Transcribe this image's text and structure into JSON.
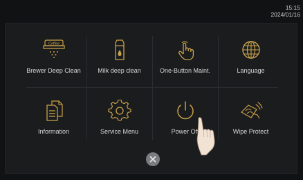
{
  "status": {
    "time": "15:15",
    "date": "2024/01/16"
  },
  "menu": {
    "items": [
      {
        "label": "Brewer Deep Clean",
        "icon": "coffee-brewer-icon"
      },
      {
        "label": "Milk deep clean",
        "icon": "milk-carton-icon"
      },
      {
        "label": "One-Button Maint.",
        "icon": "touch-hand-icon"
      },
      {
        "label": "Language",
        "icon": "globe-icon"
      },
      {
        "label": "Information",
        "icon": "documents-icon"
      },
      {
        "label": "Service Menu",
        "icon": "gear-icon"
      },
      {
        "label": "Power Off",
        "icon": "power-icon"
      },
      {
        "label": "Wipe Protect",
        "icon": "wipe-hand-icon"
      }
    ],
    "brewer_icon_text": "Coffee"
  },
  "colors": {
    "accent": "#c9a24a",
    "background": "#111213",
    "panel": "#1b1c1e"
  }
}
